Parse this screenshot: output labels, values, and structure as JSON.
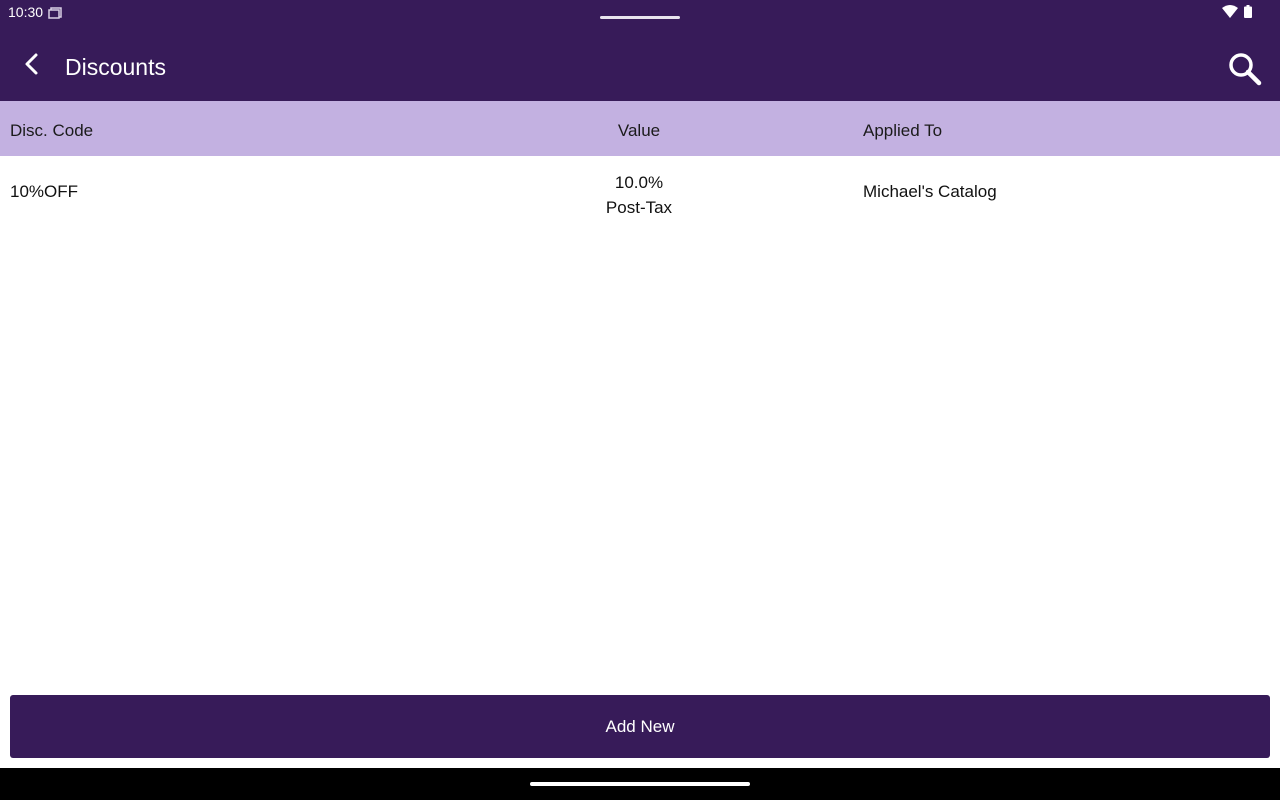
{
  "status_bar": {
    "time": "10:30",
    "notification_icon": "screenshot-notification-icon",
    "wifi_icon": "wifi-icon",
    "battery_icon": "battery-icon"
  },
  "app_bar": {
    "title": "Discounts",
    "back_icon": "chevron-left-icon",
    "search_icon": "search-icon",
    "background": "#371b59"
  },
  "table": {
    "headers": {
      "code": "Disc. Code",
      "value": "Value",
      "applied_to": "Applied To"
    },
    "header_background": "#c3b1e1",
    "rows": [
      {
        "code": "10%OFF",
        "value": "10.0%",
        "value_type": "Post-Tax",
        "applied_to": "Michael's Catalog"
      }
    ]
  },
  "footer": {
    "add_new_label": "Add New",
    "button_color": "#371b59"
  }
}
